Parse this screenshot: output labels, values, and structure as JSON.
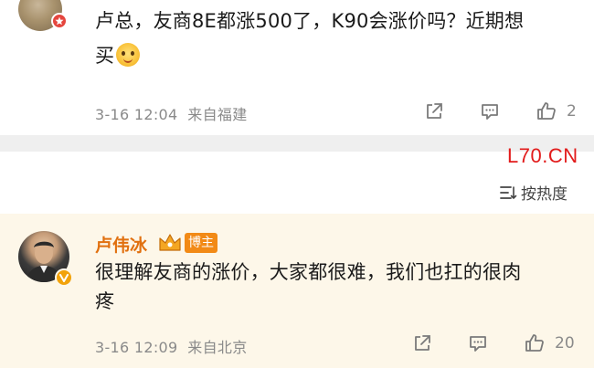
{
  "comments": [
    {
      "text_line1": "卢总，友商8E都涨500了，K90会涨价吗？近期想",
      "text_line2": "买",
      "time": "3-16 12:04",
      "location": "来自福建",
      "like_count": "2",
      "emoji": "grin-sweat-emoji"
    },
    {
      "author": "卢伟冰",
      "role_tag": "博主",
      "text_line1": "很理解友商的涨价，大家都很难，我们也扛的很肉",
      "text_line2": "疼",
      "time": "3-16 12:09",
      "location": "来自北京",
      "like_count": "20"
    }
  ],
  "watermark": "L70.CN",
  "sort": {
    "label": "按热度"
  },
  "colors": {
    "highlight_bg": "#fdf7e9",
    "author_name": "#e1700f",
    "tag_bg": "#f28a16",
    "watermark": "#e21b1b",
    "divider": "#efefef"
  }
}
